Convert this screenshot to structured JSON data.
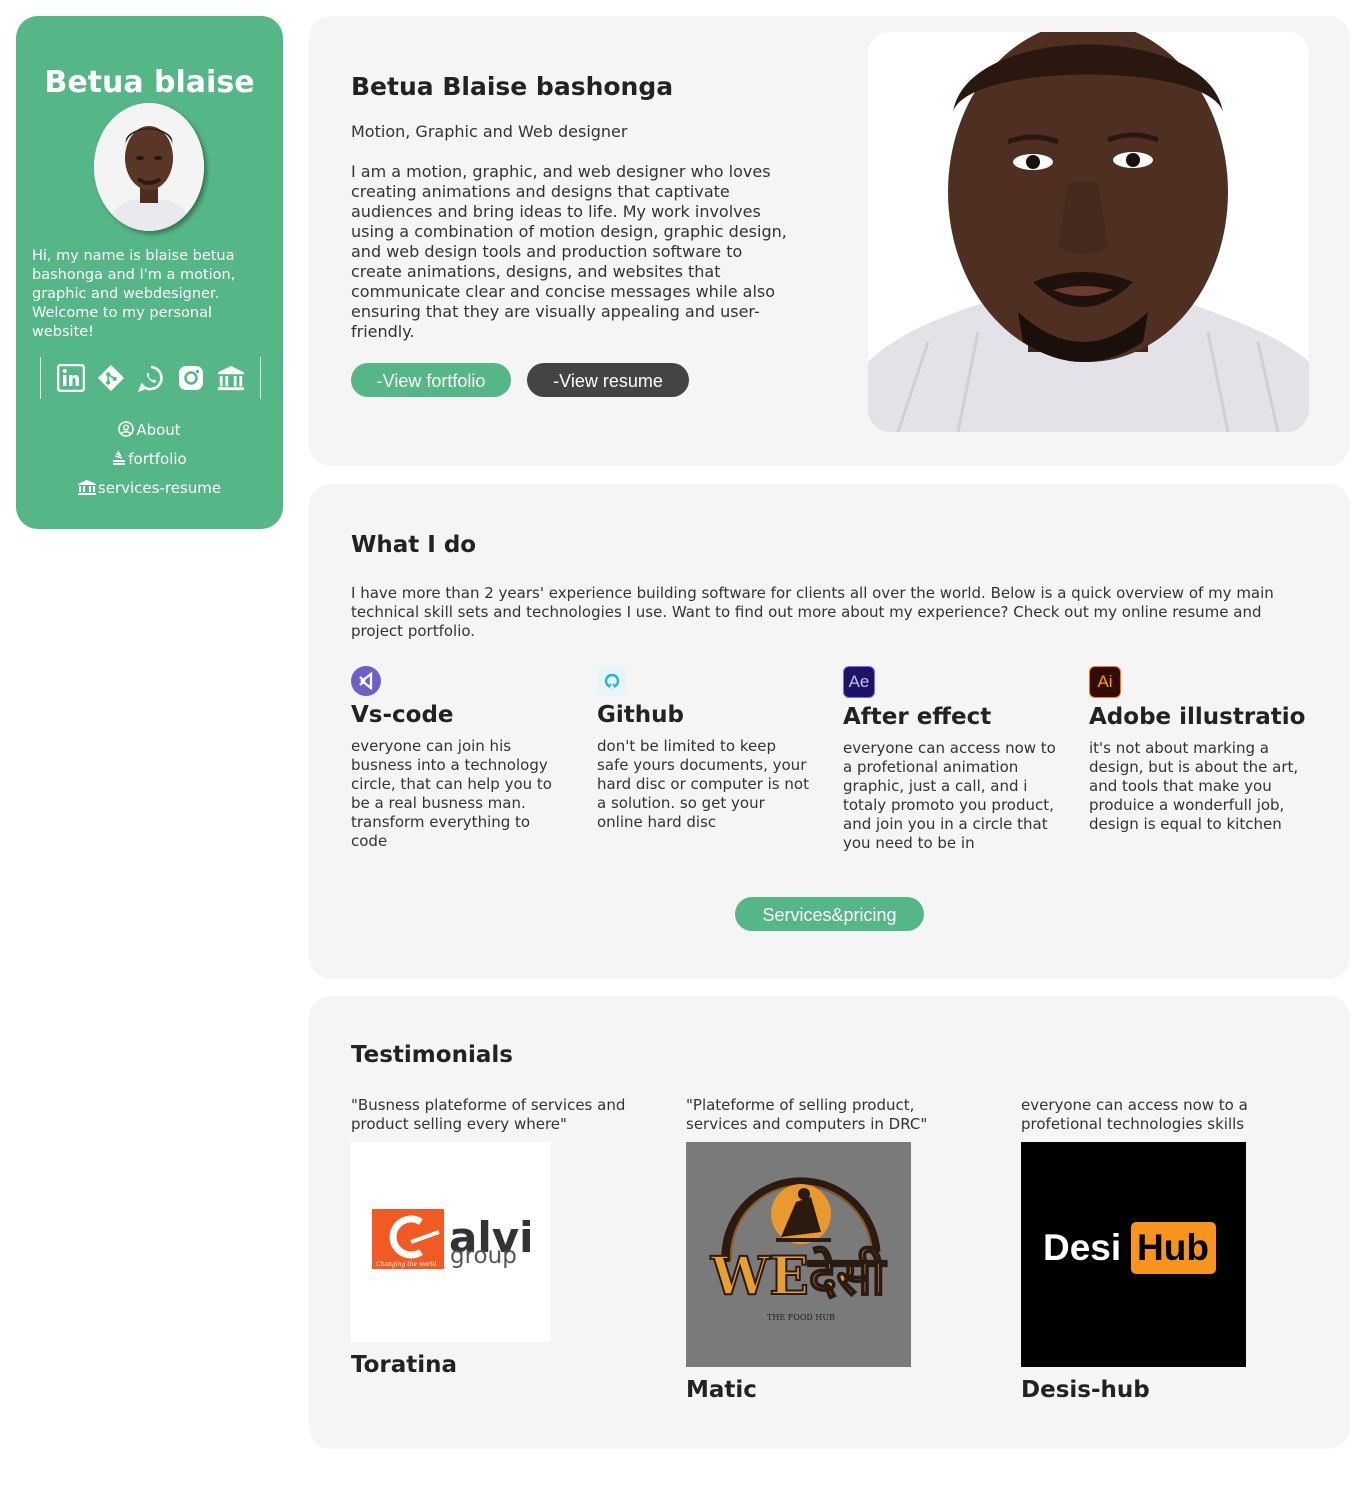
{
  "sidebar": {
    "name": "Betua blaise",
    "intro": "Hi, my name is blaise betua bashonga and I'm a motion, graphic and webdesigner. Welcome to my personal website!",
    "social_icons": [
      "linkedin-icon",
      "git-icon",
      "whatsapp-icon",
      "instagram-icon",
      "bank-icon"
    ],
    "nav": [
      {
        "label": "About",
        "icon": "user-circle-icon"
      },
      {
        "label": "fortfolio",
        "icon": "stack-icon"
      },
      {
        "label": "services-resume",
        "icon": "bank-icon"
      }
    ]
  },
  "hero": {
    "title": "Betua Blaise bashonga",
    "subtitle": "Motion, Graphic and Web designer",
    "bio": "I am a motion, graphic, and web designer who loves creating animations and designs that captivate audiences and bring ideas to life. My work involves using a combination of motion design, graphic design, and web design tools and production software to create animations, designs, and websites that communicate clear and concise messages while also ensuring that they are visually appealing and user-friendly.",
    "portfolio_button": "-View fortfolio",
    "resume_button": "-View resume"
  },
  "what_i_do": {
    "title": "What I do",
    "intro": "I have more than 2 years' experience building software for clients all over the world. Below is a quick overview of my main technical skill sets and technologies I use. Want to find out more about my experience? Check out my online resume and project portfolio.",
    "skills": [
      {
        "name": "Vs-code",
        "icon": "vscode-icon",
        "desc": "everyone can join his busness into a technology circle, that can help you to be a real busness man. transform everything to code"
      },
      {
        "name": "Github",
        "icon": "github-icon",
        "desc": "don't be limited to keep safe yours documents, your hard disc or computer is not a solution. so get your online hard disc"
      },
      {
        "name": "After effect",
        "icon": "after-effects-icon",
        "badge": "Ae",
        "desc": "everyone can access now to a profetional animation graphic, just a call, and i totaly promoto you product, and join you in a circle that you need to be in"
      },
      {
        "name": "Adobe illustratio",
        "icon": "illustrator-icon",
        "badge": "Ai",
        "desc": "it's not about marking a design, but is about the art, and tools that make you produice a wonderfull job, design is equal to kitchen"
      }
    ],
    "button": "Services&pricing"
  },
  "testimonials": {
    "title": "Testimonials",
    "items": [
      {
        "quote": "\"Busness plateforme of services and product selling every where\"",
        "name": "Toratina",
        "logo_text_a": "alvi",
        "logo_text_b": "group",
        "logo_tagline": "Changing the world"
      },
      {
        "quote": "\"Plateforme of selling product, services and computers in DRC\"",
        "name": "Matic",
        "logo_text": "WEदेसी",
        "logo_tagline": "THE FOOD HUB"
      },
      {
        "quote": "everyone can access now to a profetional technologies skills",
        "name": "Desis-hub",
        "logo_text_a": "Desi",
        "logo_text_b": "Hub"
      }
    ]
  },
  "colors": {
    "accent": "#55b688",
    "dark_button": "#444444",
    "card": "#f5f5f5"
  }
}
